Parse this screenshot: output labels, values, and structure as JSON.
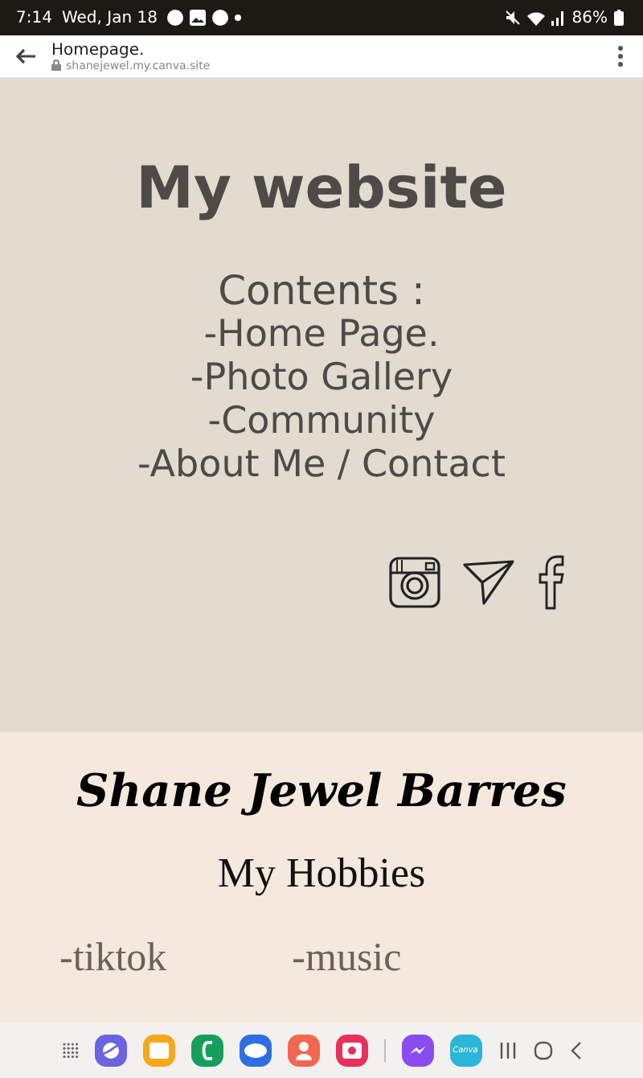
{
  "status_bar": {
    "time": "7:14",
    "date": "Wed, Jan 18",
    "battery": "86%"
  },
  "browser_bar": {
    "title": "Homepage.",
    "url": "shanejewel.my.canva.site"
  },
  "hero": {
    "title": "My website",
    "contents_heading": "Contents :",
    "contents": [
      "-Home Page.",
      "-Photo Gallery",
      "-Community",
      "-About Me / Contact"
    ]
  },
  "about": {
    "name": "Shane Jewel Barres",
    "heading": "My Hobbies",
    "hobbies": [
      "-tiktok",
      "-music"
    ]
  },
  "dock": {
    "apps": [
      {
        "kind": "internet",
        "color": "#6b63e0"
      },
      {
        "kind": "files",
        "color": "#f6a81c"
      },
      {
        "kind": "phone",
        "color": "#14a05c"
      },
      {
        "kind": "messages",
        "color": "#2d6fe0"
      },
      {
        "kind": "contacts",
        "color": "#f4664f"
      },
      {
        "kind": "camera",
        "color": "#e8305a"
      },
      {
        "kind": "messenger",
        "color": "#8a4cf0"
      },
      {
        "kind": "canva",
        "color": "#2bb5d6",
        "label": "Canva"
      }
    ]
  }
}
